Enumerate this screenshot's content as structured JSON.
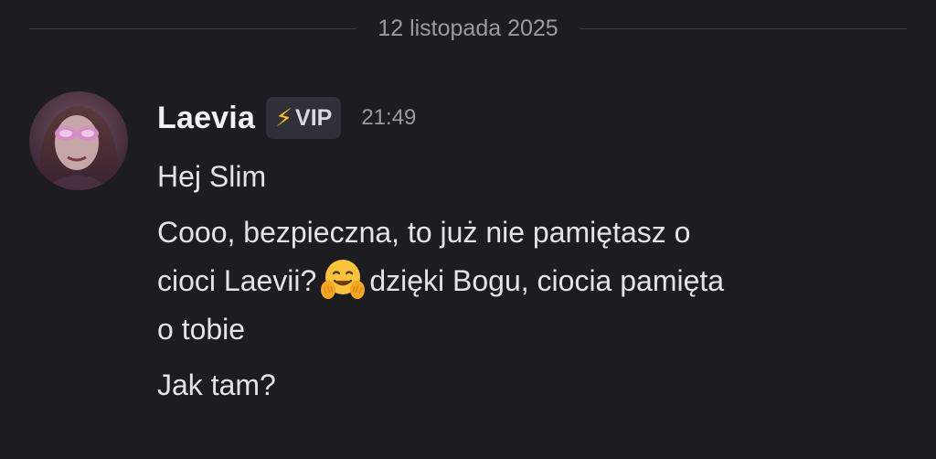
{
  "date_divider": "12 listopada 2025",
  "message": {
    "author": "Laevia",
    "badge": {
      "icon": "lightning-bolt-icon",
      "icon_glyph": "⚡",
      "label": "VIP"
    },
    "timestamp": "21:49",
    "avatar_icon": "user-avatar"
  },
  "messages": [
    {
      "text": "Hej Slim"
    },
    {
      "text": "Cooo, bezpieczna, to już nie pamiętasz o\ncioci Laevii?",
      "emoji": "hugging-face-icon",
      "text_after": "dzięki Bogu, ciocia pamięta\no tobie"
    },
    {
      "text": "Jak tam?"
    }
  ],
  "colors": {
    "background": "#1c1c21",
    "badge_bg": "#2f3038",
    "lightning": "#f5c21b",
    "muted": "#9a9aa3",
    "text": "#e4e4e8"
  }
}
